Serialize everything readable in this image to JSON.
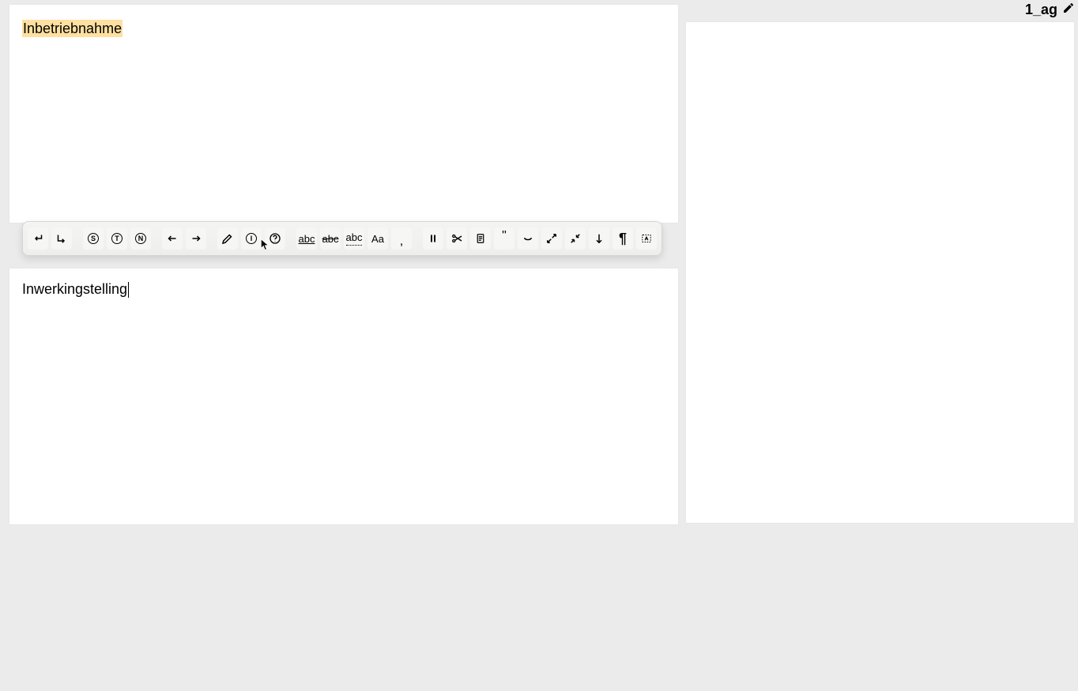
{
  "notes": {
    "title": "1_ag"
  },
  "source": {
    "text": "Inbetriebnahme"
  },
  "target": {
    "text": "Inwerkingstelling"
  },
  "toolbar": {
    "b1": "↵",
    "b5_letter": "S",
    "b6_letter": "T",
    "b7_letter": "N",
    "b11_letter": "I",
    "b13": "abc",
    "b14": "abc",
    "b15": "abc",
    "b16": "Aa",
    "b17": ",",
    "b21": "\"",
    "b26": "¶"
  }
}
